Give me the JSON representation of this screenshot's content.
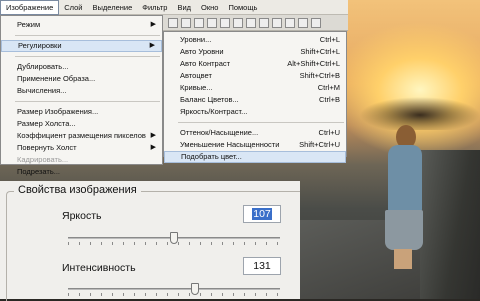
{
  "menubar": {
    "items": [
      "Изображение",
      "Слой",
      "Выделение",
      "Фильтр",
      "Вид",
      "Окно",
      "Помощь"
    ]
  },
  "image_menu": {
    "items": [
      {
        "label": "Режим",
        "submenu": true
      },
      {
        "label": "Регулировки",
        "submenu": true,
        "highlighted": true
      },
      {
        "label": "Дублировать..."
      },
      {
        "label": "Применение Образа..."
      },
      {
        "label": "Вычисления..."
      },
      {
        "label": "Размер Изображения..."
      },
      {
        "label": "Размер Холста..."
      },
      {
        "label": "Коэффициент размещения пикселов",
        "submenu": true
      },
      {
        "label": "Повернуть Холст",
        "submenu": true
      },
      {
        "label": "Кадрировать...",
        "disabled": true
      },
      {
        "label": "Подрезать..."
      }
    ]
  },
  "adjust_menu": {
    "items": [
      {
        "label": "Уровни...",
        "shortcut": "Ctrl+L"
      },
      {
        "label": "Авто Уровни",
        "shortcut": "Shift+Ctrl+L"
      },
      {
        "label": "Авто Контраст",
        "shortcut": "Alt+Shift+Ctrl+L"
      },
      {
        "label": "Автоцвет",
        "shortcut": "Shift+Ctrl+B"
      },
      {
        "label": "Кривые...",
        "shortcut": "Ctrl+M"
      },
      {
        "label": "Баланс Цветов...",
        "shortcut": "Ctrl+B"
      },
      {
        "label": "Яркость/Контраст..."
      },
      {
        "label": "Оттенок/Насыщение...",
        "shortcut": "Ctrl+U"
      },
      {
        "label": "Уменьшение Насыщенности",
        "shortcut": "Shift+Ctrl+U"
      },
      {
        "label": "Подобрать цвет...",
        "highlighted": true
      }
    ]
  },
  "dialog": {
    "title": "Свойства изображения",
    "brightness_label": "Яркость",
    "brightness_value": "107",
    "brightness_fraction": 0.5,
    "intensity_label": "Интенсивность",
    "intensity_value": "131",
    "intensity_fraction": 0.6
  },
  "colors": {
    "highlight": "#d9e6f5",
    "selection": "#3a6fc9"
  }
}
